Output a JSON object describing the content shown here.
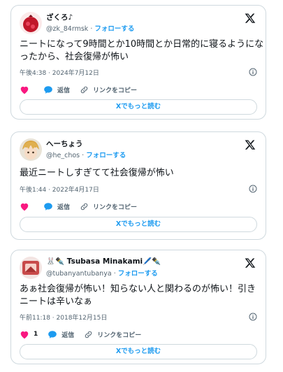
{
  "tweets": [
    {
      "name": "ざくろ♪",
      "handle": "@zk_84rmsk",
      "separator": "·",
      "follow_label": "フォローする",
      "text": "ニートになって9時間とか10時間とか日常的に寝るようになったから、社会復帰が怖い",
      "date": "午後4:38 · 2024年7月12日",
      "likes": "",
      "reply_label": "返信",
      "copy_label": "リンクをコピー",
      "more_label": "Xでもっと読む",
      "avatar_icon": "pomegranate-avatar"
    },
    {
      "name": "へーちょう",
      "handle": "@he_chos",
      "separator": "·",
      "follow_label": "フォローする",
      "text": "最近ニートしすぎてて社会復帰が怖い",
      "date": "午後1:44 · 2022年4月17日",
      "likes": "",
      "reply_label": "返信",
      "copy_label": "リンクをコピー",
      "more_label": "Xでもっと読む",
      "avatar_icon": "anime-character-avatar"
    },
    {
      "name": "🐰✒️ Tsubasa Minakami🖊️✒️",
      "handle": "@tubanyantubanya",
      "separator": "·",
      "follow_label": "フォローする",
      "text": "あぁ社会復帰が怖い！知らない人と関わるのが怖い！引きニートは辛いなぁ",
      "date": "午前11:18 · 2018年12月15日",
      "likes": "1",
      "reply_label": "返信",
      "copy_label": "リンクをコピー",
      "more_label": "Xでもっと読む",
      "avatar_icon": "illustration-avatar"
    }
  ],
  "colors": {
    "accent": "#1d9bf0",
    "like": "#f91880",
    "secondary_text": "#536471",
    "border": "#cfd9de"
  }
}
